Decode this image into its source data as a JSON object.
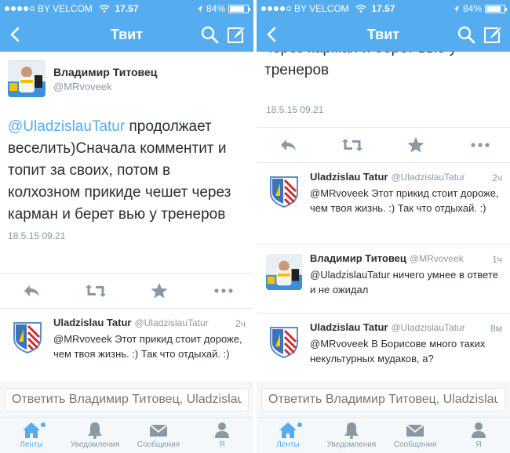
{
  "status": {
    "carrier": "BY VELCOM",
    "time": "17.57",
    "battery": "84%",
    "battery_level": 0.84
  },
  "nav": {
    "title": "Твит"
  },
  "tweet": {
    "author_name": "Владимир Титовец",
    "author_handle": "@MRvoveek",
    "mention": "@UladzislauTatur",
    "text_rest": " продолжает веселить)Сначала комментит и топит за своих, потом в колхозном прикиде чешет через карман и берет вью у тренеров",
    "scrolled_fragment": "через карман и берет вью у тренеров",
    "timestamp": "18.5.15 09.21"
  },
  "replies": [
    {
      "name": "Uladzislau Tatur",
      "handle": "@UladzislauTatur",
      "time": "2ч",
      "text": "@MRvoveek Этот прикид стоит дороже, чем твоя жизнь. :) Так что отдыхай. :)"
    },
    {
      "name": "Владимир Титовец",
      "handle": "@MRvoveek",
      "time": "1ч",
      "text": "@UladzislauTatur ничего умнее в ответе и не ожидал"
    },
    {
      "name": "Uladzislau Tatur",
      "handle": "@UladzislauTatur",
      "time": "8м",
      "text": "@MRvoveek В Борисове много таких некультурных мудаков, а?"
    }
  ],
  "reply_bar": {
    "placeholder": "Ответить Владимир Титовец, Uladzislau"
  },
  "tabs": [
    {
      "label": "Ленты",
      "icon": "home-icon",
      "active": true
    },
    {
      "label": "Уведомления",
      "icon": "bell-icon",
      "active": false
    },
    {
      "label": "Сообщения",
      "icon": "envelope-icon",
      "active": false
    },
    {
      "label": "Я",
      "icon": "person-icon",
      "active": false
    }
  ],
  "colors": {
    "accent": "#55acee",
    "text": "#292f33",
    "muted": "#8899a6",
    "divider": "#e1e8ed"
  }
}
